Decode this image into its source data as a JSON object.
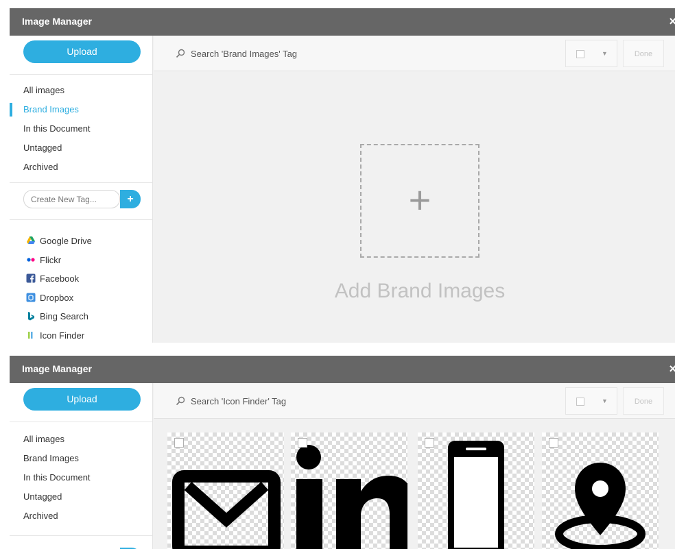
{
  "colors": {
    "accent": "#2eaee0",
    "titlebar": "#666666"
  },
  "panel1": {
    "title": "Image Manager",
    "close": "×",
    "upload": "Upload",
    "nav": [
      "All images",
      "Brand Images",
      "In this Document",
      "Untagged",
      "Archived"
    ],
    "active_nav": "Brand Images",
    "tag_placeholder": "Create New Tag...",
    "tag_add": "+",
    "sources": [
      {
        "label": "Google Drive",
        "icon": "google-drive-icon"
      },
      {
        "label": "Flickr",
        "icon": "flickr-icon"
      },
      {
        "label": "Facebook",
        "icon": "facebook-icon"
      },
      {
        "label": "Dropbox",
        "icon": "dropbox-icon"
      },
      {
        "label": "Bing Search",
        "icon": "bing-icon"
      },
      {
        "label": "Icon Finder",
        "icon": "iconfinder-icon"
      }
    ],
    "search_placeholder": "Search 'Brand Images' Tag",
    "done": "Done",
    "dropzone_plus": "+",
    "add_label": "Add Brand Images"
  },
  "panel2": {
    "title": "Image Manager",
    "close": "×",
    "upload": "Upload",
    "nav": [
      "All images",
      "Brand Images",
      "In this Document",
      "Untagged",
      "Archived"
    ],
    "search_placeholder": "Search 'Icon Finder' Tag",
    "done": "Done",
    "tiles": [
      "mail-icon",
      "linkedin-icon",
      "smartphone-icon",
      "location-pin-icon"
    ]
  }
}
